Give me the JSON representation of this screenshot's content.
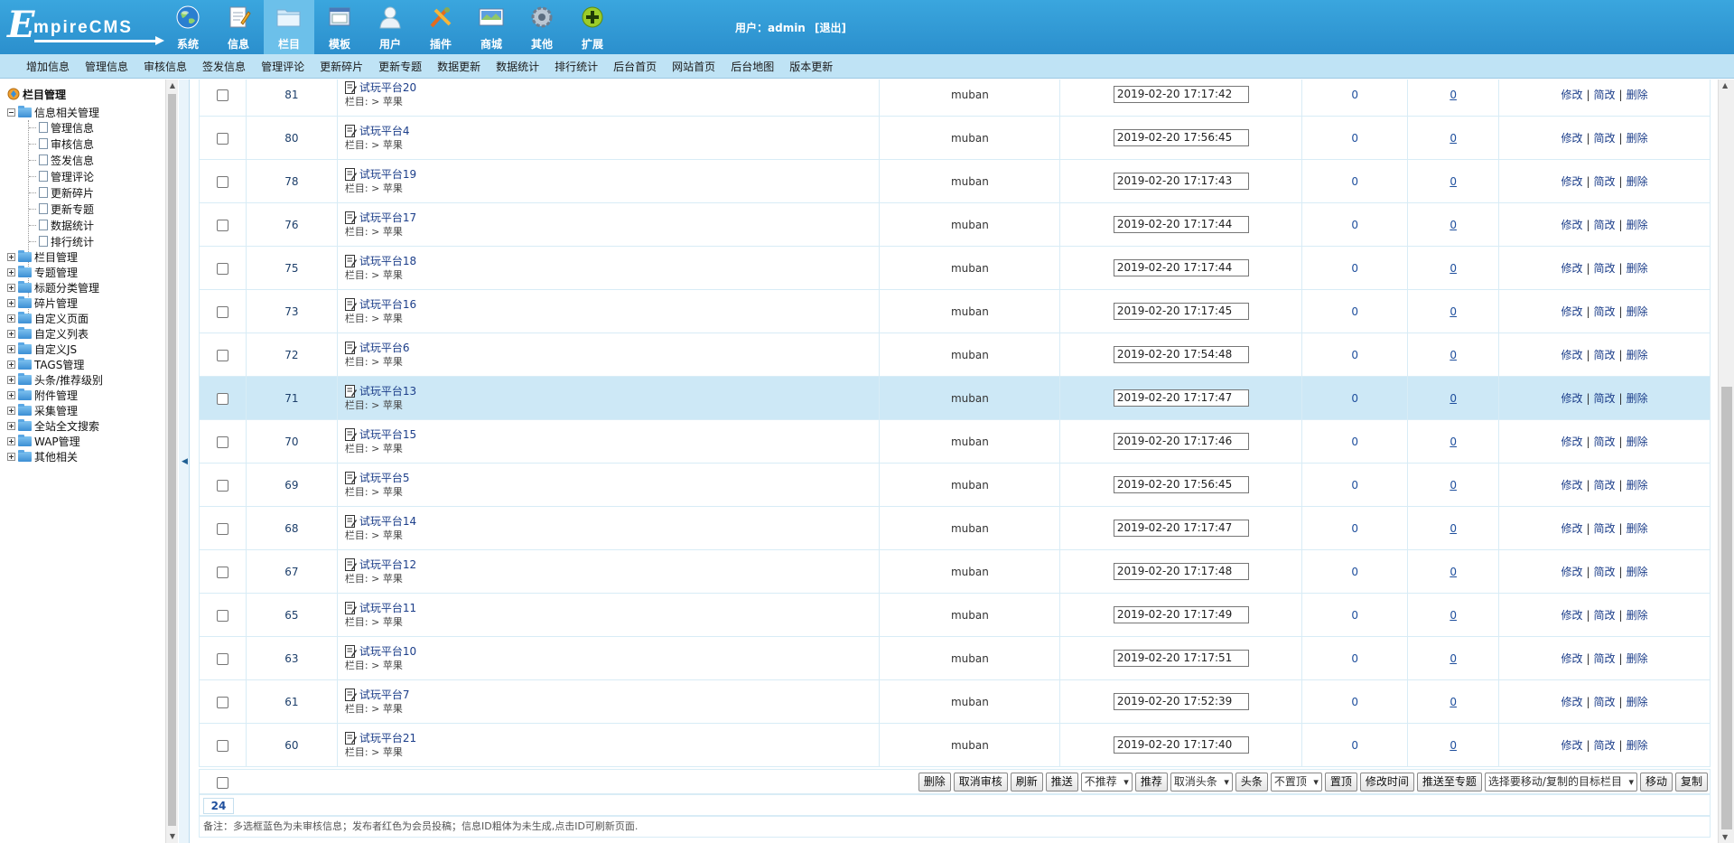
{
  "app": {
    "logo_big": "E",
    "logo_rest": "mpireCMS"
  },
  "nav": [
    {
      "label": "系统",
      "icon": "globe-icon"
    },
    {
      "label": "信息",
      "icon": "notepad-icon"
    },
    {
      "label": "栏目",
      "icon": "folder-icon"
    },
    {
      "label": "模板",
      "icon": "window-icon"
    },
    {
      "label": "用户",
      "icon": "user-icon"
    },
    {
      "label": "插件",
      "icon": "tools-icon"
    },
    {
      "label": "商城",
      "icon": "shop-icon"
    },
    {
      "label": "其他",
      "icon": "gear-icon"
    },
    {
      "label": "扩展",
      "icon": "plus-circle-icon"
    }
  ],
  "nav_active": "栏目",
  "user": {
    "label": "用户：admin",
    "logout": "[退出]"
  },
  "submenu": [
    "增加信息",
    "管理信息",
    "审核信息",
    "签发信息",
    "管理评论",
    "更新碎片",
    "更新专题",
    "数据更新",
    "数据统计",
    "排行统计",
    "后台首页",
    "网站首页",
    "后台地图",
    "版本更新"
  ],
  "tree": {
    "root": "栏目管理",
    "group": "信息相关管理",
    "children": [
      "管理信息",
      "审核信息",
      "签发信息",
      "管理评论",
      "更新碎片",
      "更新专题",
      "数据统计",
      "排行统计"
    ],
    "sections": [
      "栏目管理",
      "专题管理",
      "标题分类管理",
      "碎片管理",
      "自定义页面",
      "自定义列表",
      "自定义JS",
      "TAGS管理",
      "头条/推荐级别",
      "附件管理",
      "采集管理",
      "全站全文搜索",
      "WAP管理",
      "其他相关"
    ]
  },
  "rows": [
    {
      "id": "81",
      "title": "试玩平台20",
      "cat": "栏目: > 苹果",
      "user": "muban",
      "time": "2019-02-20 17:17:42",
      "hits": "0",
      "comments": "0"
    },
    {
      "id": "80",
      "title": "试玩平台4",
      "cat": "栏目: > 苹果",
      "user": "muban",
      "time": "2019-02-20 17:56:45",
      "hits": "0",
      "comments": "0"
    },
    {
      "id": "78",
      "title": "试玩平台19",
      "cat": "栏目: > 苹果",
      "user": "muban",
      "time": "2019-02-20 17:17:43",
      "hits": "0",
      "comments": "0"
    },
    {
      "id": "76",
      "title": "试玩平台17",
      "cat": "栏目: > 苹果",
      "user": "muban",
      "time": "2019-02-20 17:17:44",
      "hits": "0",
      "comments": "0"
    },
    {
      "id": "75",
      "title": "试玩平台18",
      "cat": "栏目: > 苹果",
      "user": "muban",
      "time": "2019-02-20 17:17:44",
      "hits": "0",
      "comments": "0"
    },
    {
      "id": "73",
      "title": "试玩平台16",
      "cat": "栏目: > 苹果",
      "user": "muban",
      "time": "2019-02-20 17:17:45",
      "hits": "0",
      "comments": "0"
    },
    {
      "id": "72",
      "title": "试玩平台6",
      "cat": "栏目: > 苹果",
      "user": "muban",
      "time": "2019-02-20 17:54:48",
      "hits": "0",
      "comments": "0"
    },
    {
      "id": "71",
      "title": "试玩平台13",
      "cat": "栏目: > 苹果",
      "user": "muban",
      "time": "2019-02-20 17:17:47",
      "hits": "0",
      "comments": "0",
      "highlight": true
    },
    {
      "id": "70",
      "title": "试玩平台15",
      "cat": "栏目: > 苹果",
      "user": "muban",
      "time": "2019-02-20 17:17:46",
      "hits": "0",
      "comments": "0"
    },
    {
      "id": "69",
      "title": "试玩平台5",
      "cat": "栏目: > 苹果",
      "user": "muban",
      "time": "2019-02-20 17:56:45",
      "hits": "0",
      "comments": "0"
    },
    {
      "id": "68",
      "title": "试玩平台14",
      "cat": "栏目: > 苹果",
      "user": "muban",
      "time": "2019-02-20 17:17:47",
      "hits": "0",
      "comments": "0"
    },
    {
      "id": "67",
      "title": "试玩平台12",
      "cat": "栏目: > 苹果",
      "user": "muban",
      "time": "2019-02-20 17:17:48",
      "hits": "0",
      "comments": "0"
    },
    {
      "id": "65",
      "title": "试玩平台11",
      "cat": "栏目: > 苹果",
      "user": "muban",
      "time": "2019-02-20 17:17:49",
      "hits": "0",
      "comments": "0"
    },
    {
      "id": "63",
      "title": "试玩平台10",
      "cat": "栏目: > 苹果",
      "user": "muban",
      "time": "2019-02-20 17:17:51",
      "hits": "0",
      "comments": "0"
    },
    {
      "id": "61",
      "title": "试玩平台7",
      "cat": "栏目: > 苹果",
      "user": "muban",
      "time": "2019-02-20 17:52:39",
      "hits": "0",
      "comments": "0"
    },
    {
      "id": "60",
      "title": "试玩平台21",
      "cat": "栏目: > 苹果",
      "user": "muban",
      "time": "2019-02-20 17:17:40",
      "hits": "0",
      "comments": "0"
    }
  ],
  "ops": {
    "edit": "修改",
    "simple_edit": "简改",
    "delete": "删除"
  },
  "toolbar": {
    "delete": "删除",
    "cancel_review": "取消审核",
    "refresh": "刷新",
    "push": "推送",
    "recommend_select": "不推荐",
    "recommend": "推荐",
    "headline_select": "取消头条",
    "headline": "头条",
    "top_select": "不置顶",
    "top": "置顶",
    "modify_time": "修改时间",
    "push_topic": "推送至专题",
    "target_select": "选择要移动/复制的目标栏目",
    "move": "移动",
    "copy": "复制"
  },
  "pager": {
    "current": "24"
  },
  "note": "备注：多选框蓝色为未审核信息；发布者红色为会员投稿；信息ID粗体为未生成,点击ID可刷新页面.",
  "colors": {
    "header": "#2b8fcd",
    "submenu": "#bfe3f5",
    "highlight_row": "#cde8f6",
    "link": "#1c3e8a"
  }
}
